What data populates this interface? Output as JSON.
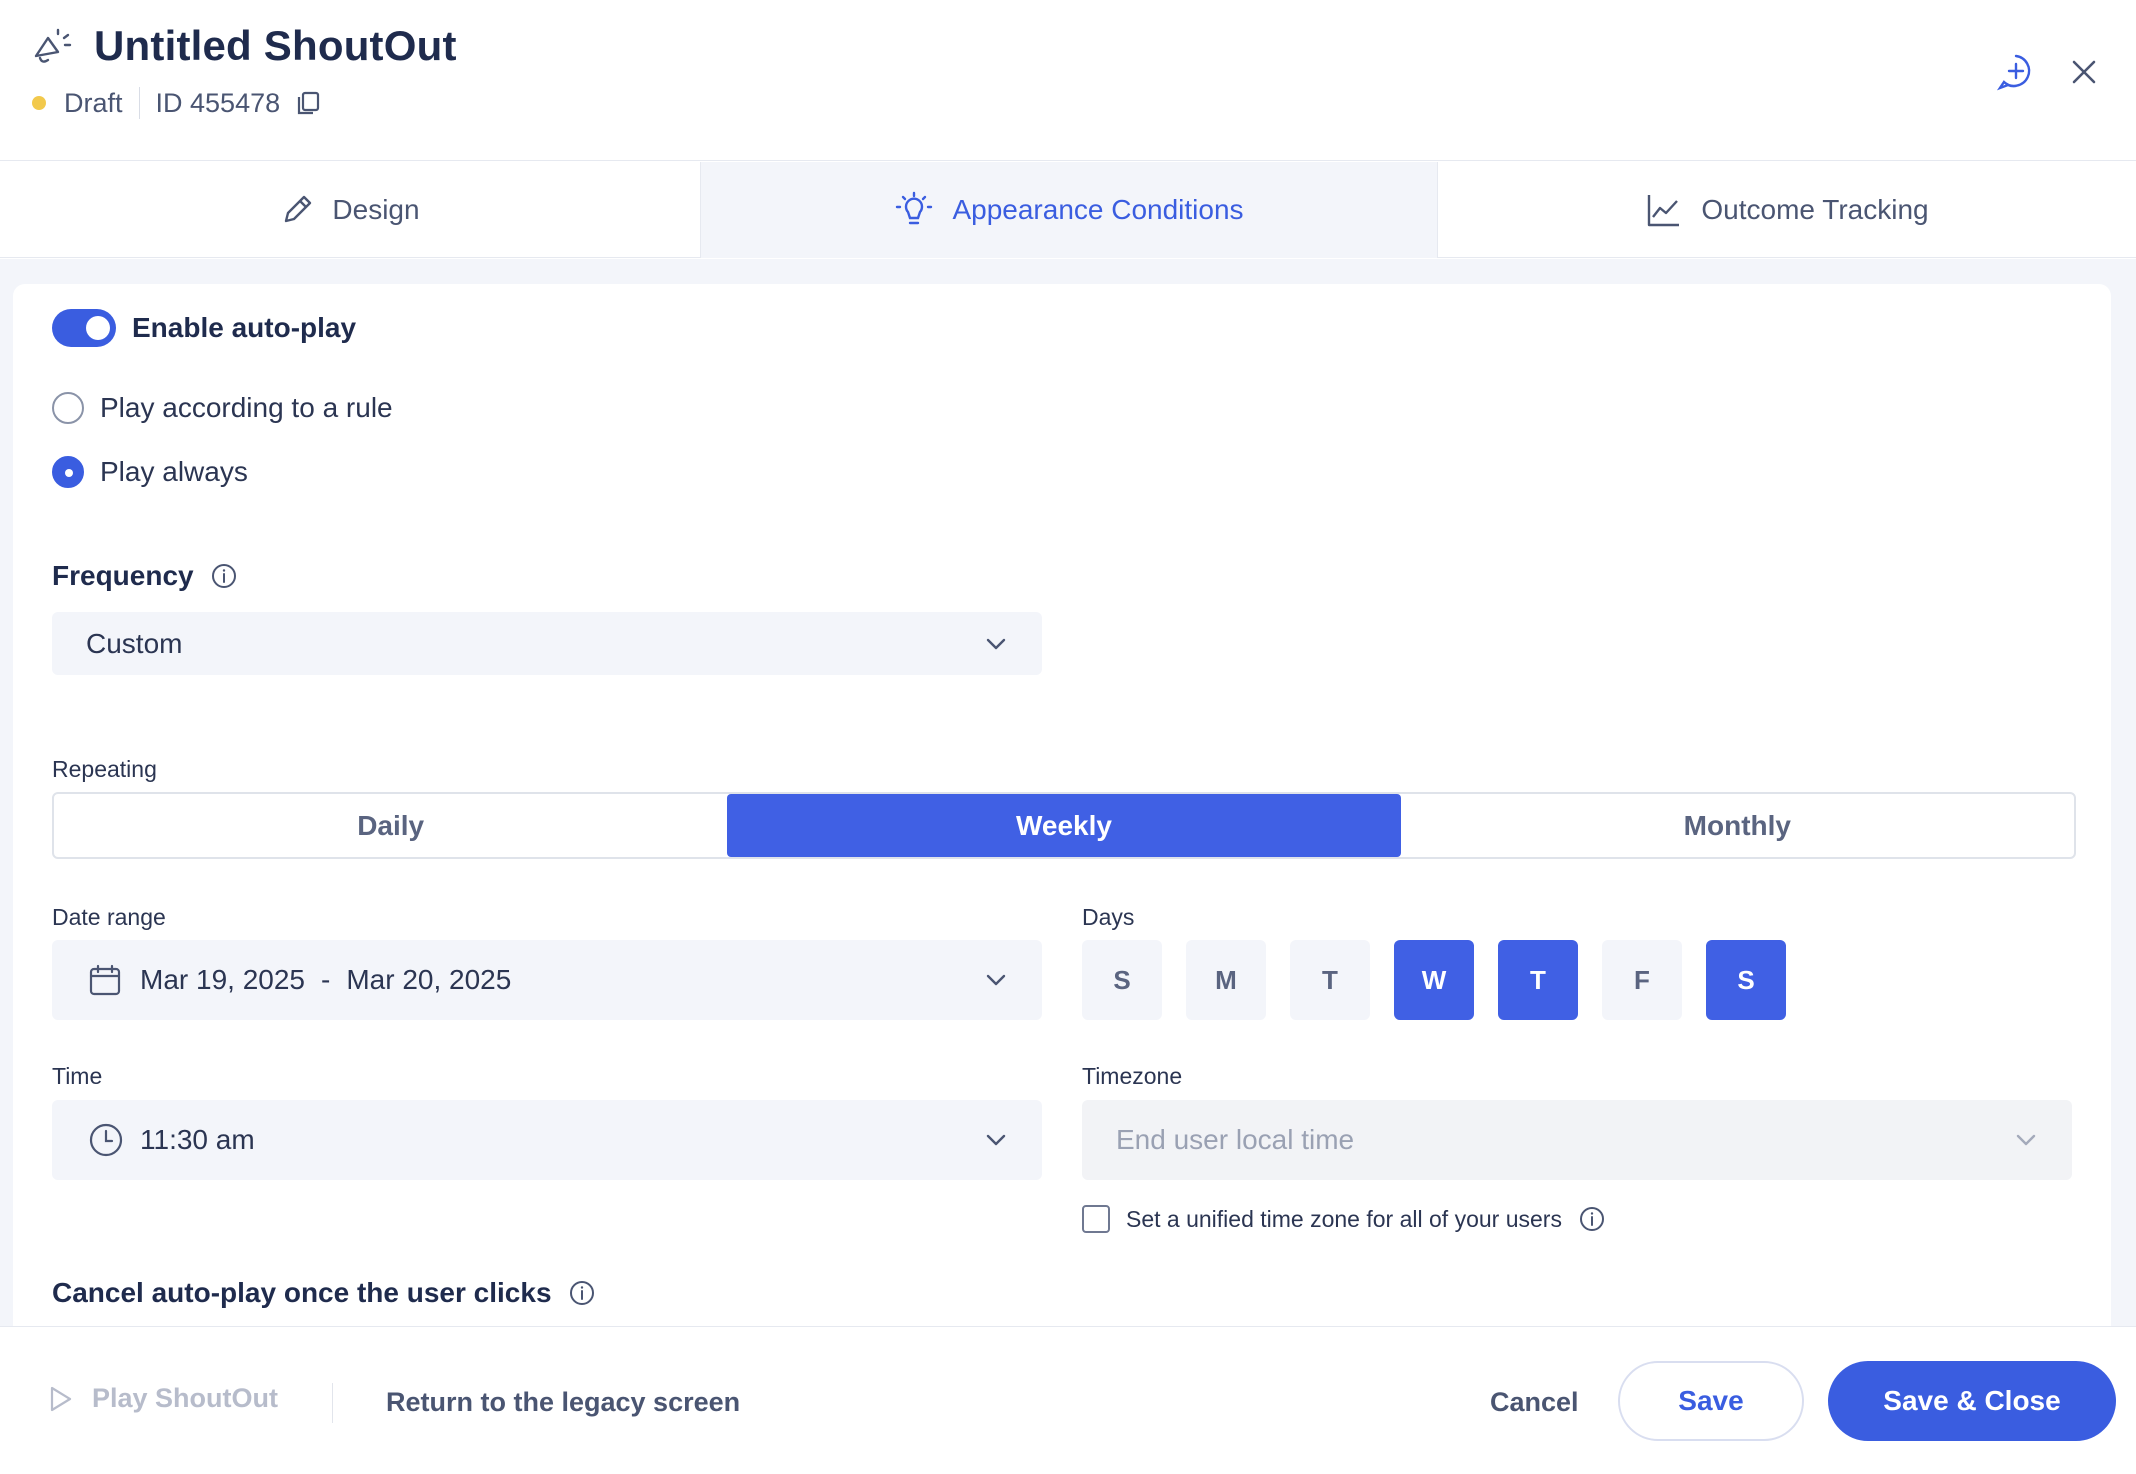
{
  "header": {
    "title": "Untitled ShoutOut",
    "status": "Draft",
    "id_label": "ID 455478",
    "status_color": "#f2c94c"
  },
  "tabs": [
    {
      "label": "Design",
      "icon": "pencil-icon"
    },
    {
      "label": "Appearance Conditions",
      "icon": "lightbulb-icon",
      "active": true
    },
    {
      "label": "Outcome Tracking",
      "icon": "line-chart-icon"
    }
  ],
  "autoplay": {
    "toggle_label": "Enable auto-play",
    "enabled": true,
    "options": [
      {
        "label": "Play according to a rule",
        "checked": false
      },
      {
        "label": "Play always",
        "checked": true
      }
    ]
  },
  "frequency": {
    "label": "Frequency",
    "value": "Custom"
  },
  "repeating": {
    "label": "Repeating",
    "options": [
      "Daily",
      "Weekly",
      "Monthly"
    ],
    "selected": "Weekly"
  },
  "date_range": {
    "label": "Date range",
    "start": "Mar 19, 2025",
    "separator": "-",
    "end": "Mar 20, 2025"
  },
  "days": {
    "label": "Days",
    "items": [
      {
        "letter": "S",
        "active": false
      },
      {
        "letter": "M",
        "active": false
      },
      {
        "letter": "T",
        "active": false
      },
      {
        "letter": "W",
        "active": true
      },
      {
        "letter": "T",
        "active": true
      },
      {
        "letter": "F",
        "active": false
      },
      {
        "letter": "S",
        "active": true
      }
    ]
  },
  "time": {
    "label": "Time",
    "value": "11:30 am"
  },
  "timezone": {
    "label": "Timezone",
    "value": "End user local time",
    "unified_label": "Set a unified time zone for all of your users",
    "unified_checked": false
  },
  "cancel_autoplay": {
    "label": "Cancel auto-play once the user clicks"
  },
  "footer": {
    "play_label": "Play ShoutOut",
    "legacy_label": "Return to the legacy screen",
    "cancel_label": "Cancel",
    "save_label": "Save",
    "save_close_label": "Save & Close"
  },
  "colors": {
    "accent": "#3a5de0",
    "accent_active": "#4060e4",
    "text": "#1f2b4d",
    "muted_bg": "#f3f5fa"
  }
}
